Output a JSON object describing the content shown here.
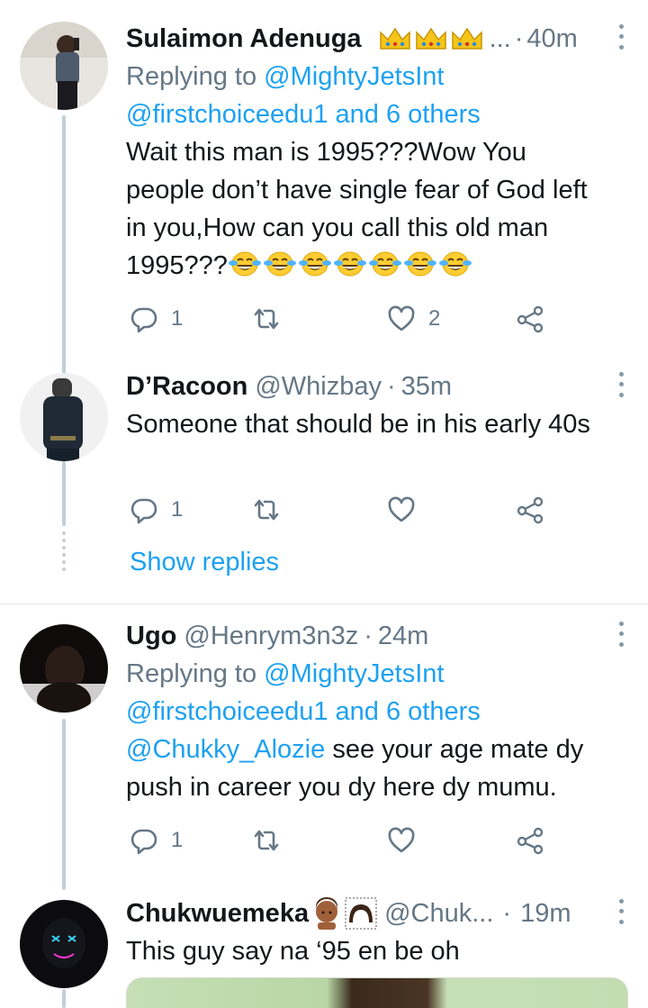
{
  "tweets": [
    {
      "name": "Sulaimon Adenuga",
      "name_suffix": "...",
      "handle": "",
      "time": "40m",
      "replying_prefix": "Replying to",
      "replying_user": "@MightyJetsInt",
      "replying_rest": "@firstchoiceedu1 and 6 others",
      "text": "Wait this man is 1995???Wow You people don’t have single fear of God left in you,How can you call this old man 1995???",
      "emoji_name": "face-with-tears-of-joy",
      "emoji_count": 7,
      "replies": "1",
      "retweets": "",
      "likes": "2"
    },
    {
      "name": "D’Racoon",
      "handle": "@Whizbay",
      "time": "35m",
      "text": "Someone that should be in his early 40s",
      "replies": "1",
      "retweets": "",
      "likes": "",
      "show_replies": "Show replies"
    },
    {
      "name": "Ugo",
      "handle": "@Henrym3n3z",
      "time": "24m",
      "replying_prefix": "Replying to",
      "replying_user": "@MightyJetsInt",
      "replying_rest": "@firstchoiceedu1 and 6 others",
      "mention": "@Chukky_Alozie",
      "text": "see your age mate dy push in career you dy here dy mumu.",
      "replies": "1",
      "retweets": "",
      "likes": ""
    },
    {
      "name": "Chukwuemeka",
      "handle": "@Chuk...",
      "time": "19m",
      "text": "This guy say na ‘95 en be oh"
    }
  ],
  "separator": "·",
  "icons": {
    "reply": "reply-icon",
    "retweet": "retweet-icon",
    "like": "heart-icon",
    "share": "share-icon",
    "menu": "more-vertical-icon",
    "crown": "crown-emoji-icon"
  },
  "colors": {
    "link": "#1da1f2",
    "secondary": "#657786",
    "thread": "#c4cfd6"
  }
}
